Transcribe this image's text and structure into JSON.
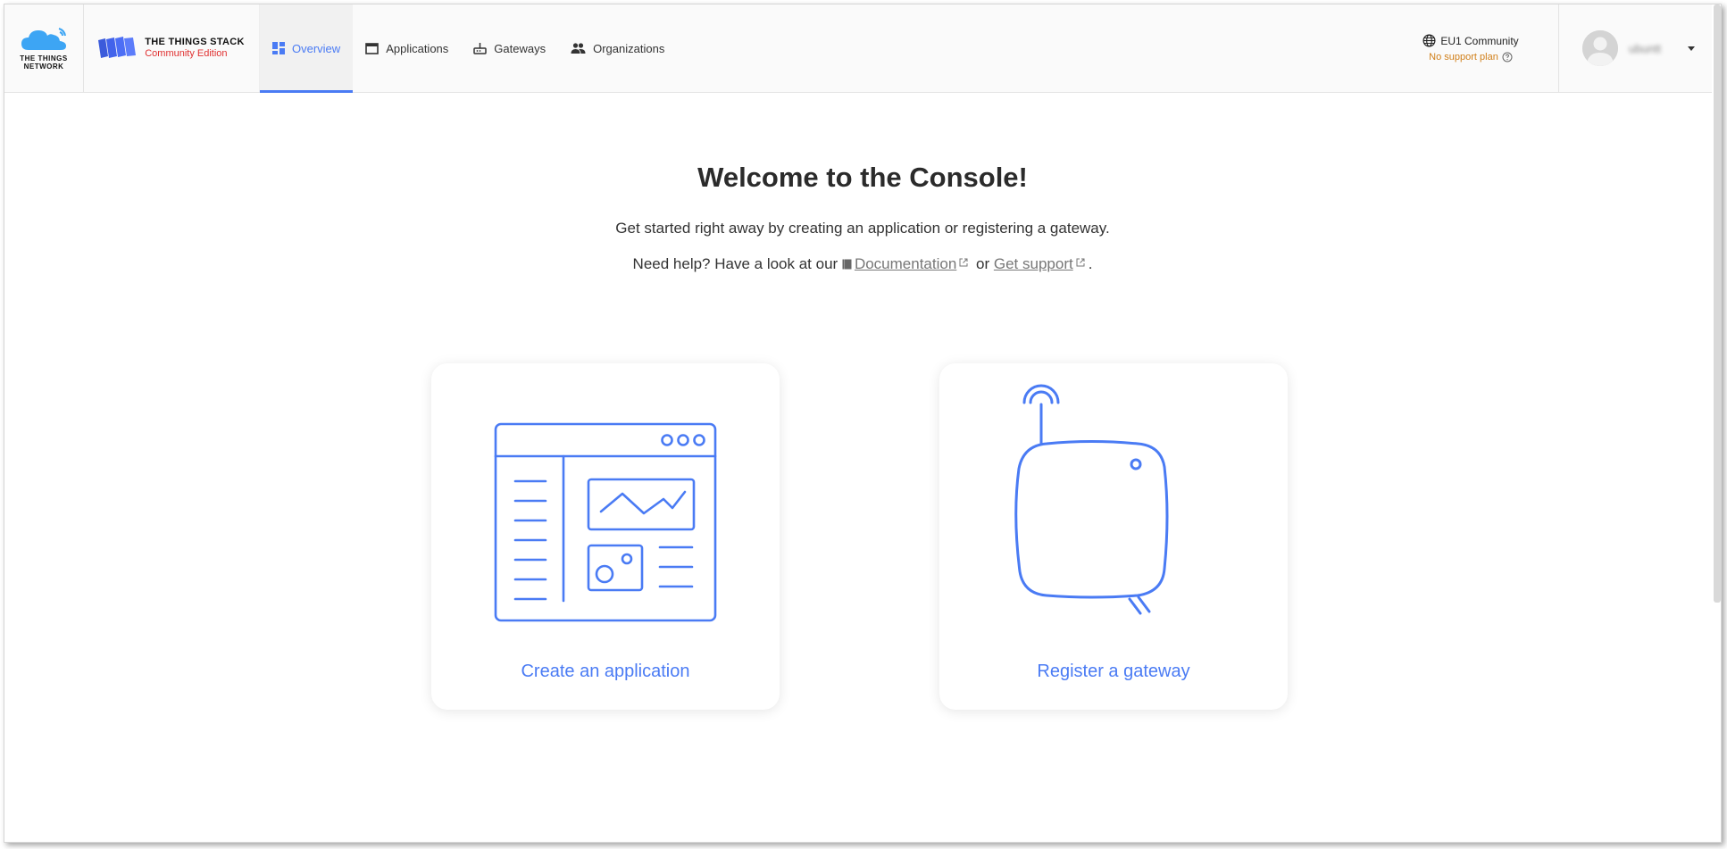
{
  "header": {
    "ttn_logo_text": [
      "THE THINGS",
      "NETWORK"
    ],
    "tts_logo": {
      "line1": "THE THINGS STACK",
      "line2": "Community Edition"
    },
    "nav": [
      {
        "label": "Overview",
        "icon": "dashboard-icon",
        "active": true
      },
      {
        "label": "Applications",
        "icon": "window-icon",
        "active": false
      },
      {
        "label": "Gateways",
        "icon": "gateway-icon",
        "active": false
      },
      {
        "label": "Organizations",
        "icon": "people-icon",
        "active": false
      }
    ],
    "cluster": {
      "name": "EU1 Community",
      "support": "No support plan"
    },
    "user": {
      "name": "ubuntt"
    }
  },
  "main": {
    "title": "Welcome to the Console!",
    "intro": "Get started right away by creating an application or registering a gateway.",
    "help": {
      "prefix": "Need help? Have a look at our",
      "doc_link": "Documentation",
      "or": "or",
      "support_link": "Get support",
      "suffix": "."
    },
    "cards": [
      {
        "label": "Create an application"
      },
      {
        "label": "Register a gateway"
      }
    ]
  },
  "colors": {
    "accent": "#4a7bf4",
    "warning": "#d07f19",
    "brand_red": "#e03131"
  }
}
